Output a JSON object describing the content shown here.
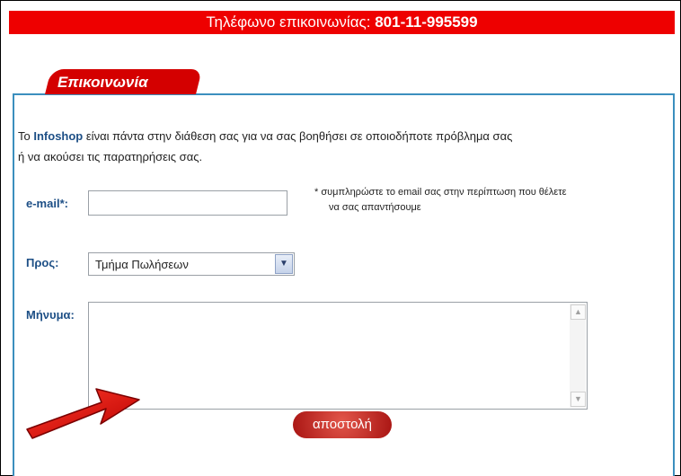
{
  "header": {
    "phone_label": "Τηλέφωνο επικοινωνίας:",
    "phone_number": "801-11-995599"
  },
  "section": {
    "title": "Επικοινωνία"
  },
  "intro": {
    "prefix": "Το",
    "brand": "Infoshop",
    "line1_rest": "είναι πάντα στην διάθεση σας για να σας βοηθήσει σε οποιοδήποτε πρόβλημα σας",
    "line2": "ή να ακούσει τις παρατηρήσεις σας."
  },
  "form": {
    "email_label": "e-mail*:",
    "email_value": "",
    "email_note_line1": "* συμπληρώστε το email σας στην περίπτωση που θέλετε",
    "email_note_line2": "να σας απαντήσουμε",
    "to_label": "Προς:",
    "to_selected": "Τμήμα Πωλήσεων",
    "message_label": "Μήνυμα:",
    "message_value": "",
    "submit_label": "αποστολή"
  },
  "colors": {
    "accent_red": "#ee0000",
    "panel_border": "#3b8fbe",
    "label_blue": "#1d4f86"
  },
  "icons": {
    "dropdown": "chevron-down-icon",
    "scroll_up": "scroll-up-icon",
    "scroll_down": "scroll-down-icon",
    "annotation": "red-arrow-icon"
  }
}
